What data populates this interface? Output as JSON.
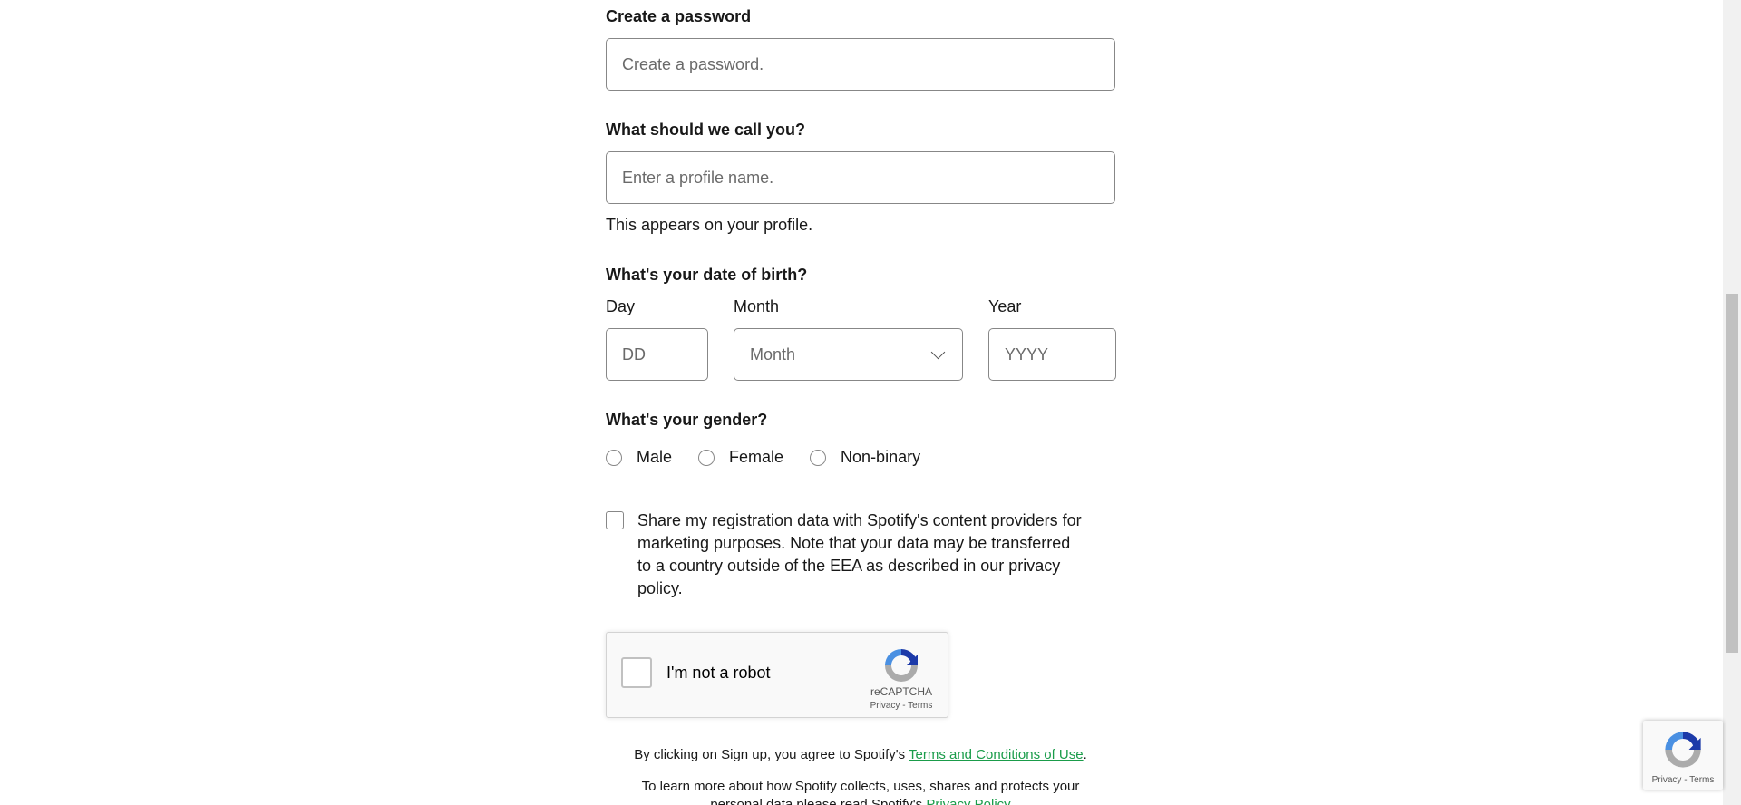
{
  "password": {
    "label": "Create a password",
    "placeholder": "Create a password."
  },
  "profile": {
    "label": "What should we call you?",
    "placeholder": "Enter a profile name.",
    "helper": "This appears on your profile."
  },
  "dob": {
    "label": "What's your date of birth?",
    "day_label": "Day",
    "day_placeholder": "DD",
    "month_label": "Month",
    "month_value": "Month",
    "year_label": "Year",
    "year_placeholder": "YYYY"
  },
  "gender": {
    "label": "What's your gender?",
    "options": [
      "Male",
      "Female",
      "Non-binary"
    ]
  },
  "consent": {
    "text": "Share my registration data with Spotify's content providers for marketing purposes. Note that your data may be transferred to a country outside of the EEA as described in our privacy policy."
  },
  "recaptcha": {
    "label": "I'm not a robot",
    "brand": "reCAPTCHA",
    "privacy": "Privacy",
    "separator": "-",
    "terms": "Terms"
  },
  "legal": {
    "line1_prefix": "By clicking on Sign up, you agree to Spotify's ",
    "line1_link": "Terms and Conditions of Use",
    "line1_suffix": ".",
    "line2_prefix": "To learn more about how Spotify collects, uses, shares and protects your",
    "line3_prefix": "personal data please read Spotify's ",
    "line3_link": "Privacy Policy"
  },
  "badge": {
    "privacy": "Privacy",
    "separator": "-",
    "terms": "Terms"
  },
  "colors": {
    "link_green": "#1a9c4a",
    "border": "#878787",
    "text": "#181818"
  },
  "icons": [
    "chevron-down-icon",
    "recaptcha-logo-icon"
  ]
}
